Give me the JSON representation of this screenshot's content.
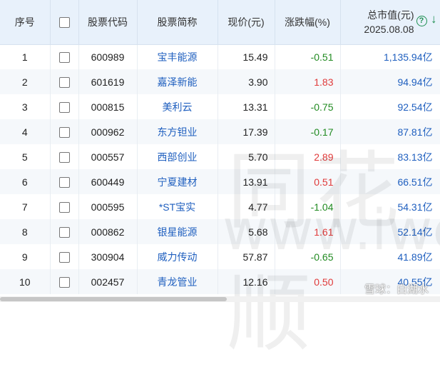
{
  "header": {
    "index": "序号",
    "code": "股票代码",
    "name": "股票简称",
    "price": "现价(元)",
    "change": "涨跌幅(%)",
    "mcap_line1": "总市值(元)",
    "mcap_line2": "2025.08.08",
    "help_icon": "?",
    "sort_icon": "↓"
  },
  "rows": [
    {
      "index": "1",
      "code": "600989",
      "name": "宝丰能源",
      "price": "15.49",
      "change": "-0.51",
      "mcap": "1,135.94亿"
    },
    {
      "index": "2",
      "code": "601619",
      "name": "嘉泽新能",
      "price": "3.90",
      "change": "1.83",
      "mcap": "94.94亿"
    },
    {
      "index": "3",
      "code": "000815",
      "name": "美利云",
      "price": "13.31",
      "change": "-0.75",
      "mcap": "92.54亿"
    },
    {
      "index": "4",
      "code": "000962",
      "name": "东方钽业",
      "price": "17.39",
      "change": "-0.17",
      "mcap": "87.81亿"
    },
    {
      "index": "5",
      "code": "000557",
      "name": "西部创业",
      "price": "5.70",
      "change": "2.89",
      "mcap": "83.13亿"
    },
    {
      "index": "6",
      "code": "600449",
      "name": "宁夏建材",
      "price": "13.91",
      "change": "0.51",
      "mcap": "66.51亿"
    },
    {
      "index": "7",
      "code": "000595",
      "name": "*ST宝实",
      "price": "4.77",
      "change": "-1.04",
      "mcap": "54.31亿"
    },
    {
      "index": "8",
      "code": "000862",
      "name": "银星能源",
      "price": "5.68",
      "change": "1.61",
      "mcap": "52.14亿"
    },
    {
      "index": "9",
      "code": "300904",
      "name": "威力传动",
      "price": "57.87",
      "change": "-0.65",
      "mcap": "41.89亿"
    },
    {
      "index": "10",
      "code": "002457",
      "name": "青龙管业",
      "price": "12.16",
      "change": "0.50",
      "mcap": "40.55亿"
    }
  ],
  "colors": {
    "up": "#e03b3b",
    "down": "#228b22",
    "link": "#1f5fbf"
  },
  "watermark": {
    "cn": "同花顺",
    "url": "www.iwe",
    "credit": "雪球：白湖水"
  }
}
